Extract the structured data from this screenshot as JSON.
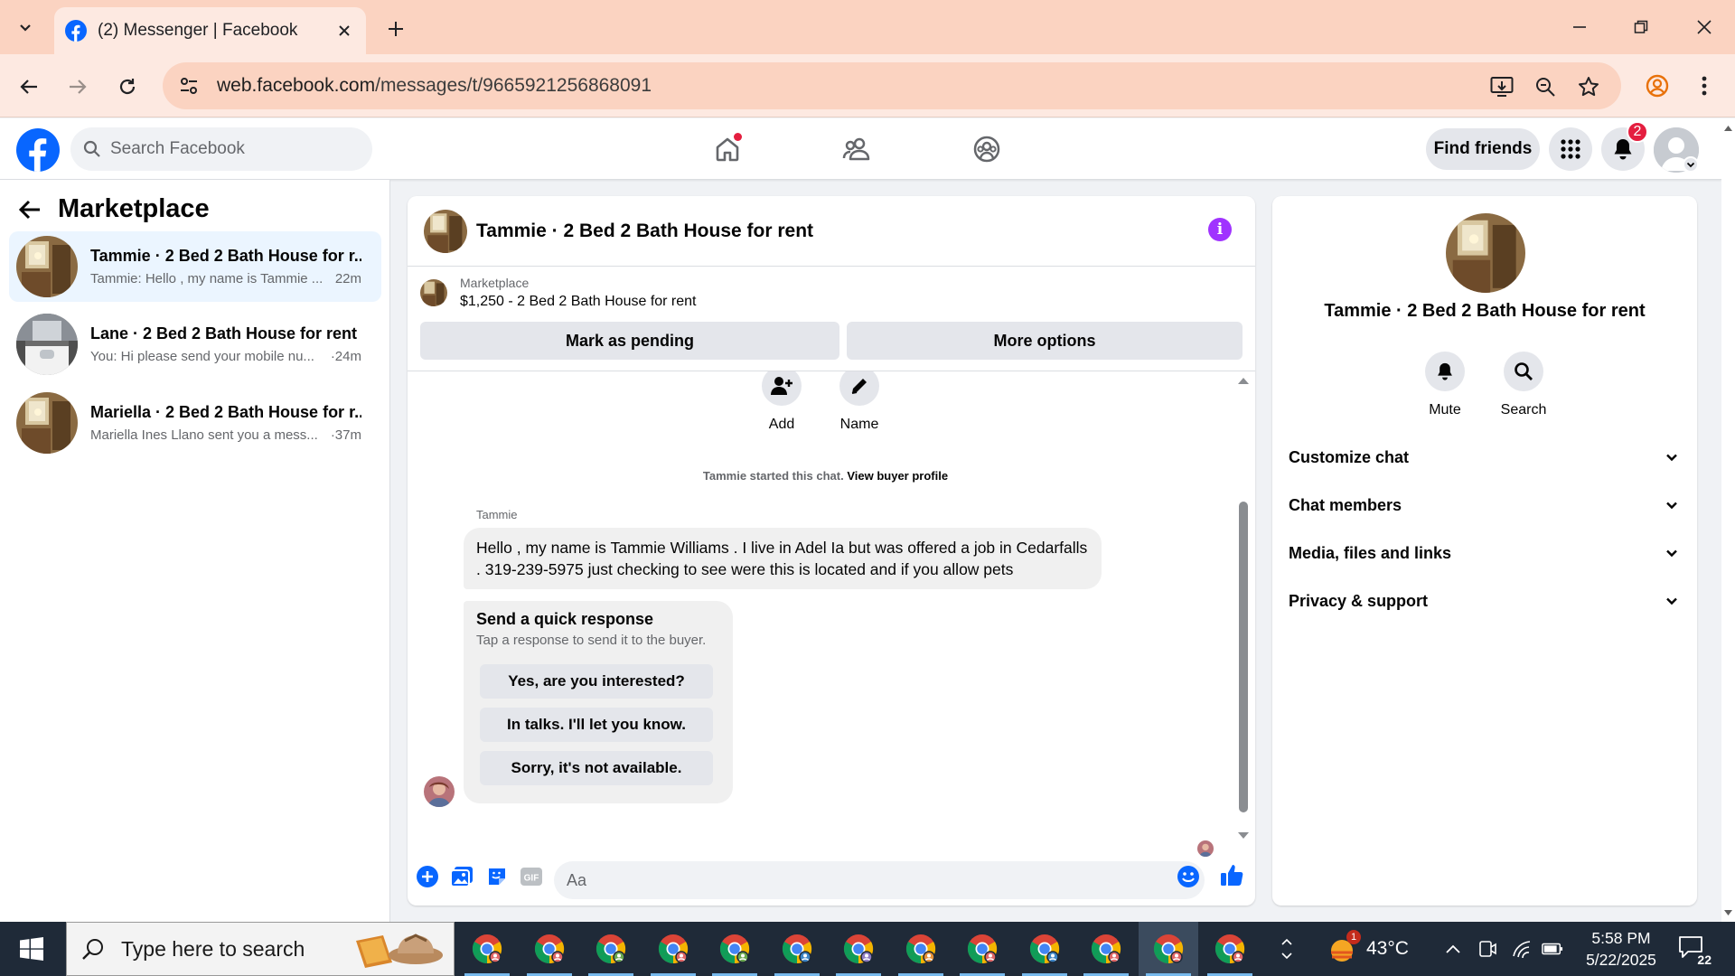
{
  "browser": {
    "tab_title": "(2) Messenger | Facebook",
    "url_host": "web.facebook.com",
    "url_path": "/messages/t/9665921256868091",
    "chrome_color": "#fbd3c1"
  },
  "facebook": {
    "search_placeholder": "Search Facebook",
    "find_friends_label": "Find friends",
    "notification_count": "2",
    "brand_color": "#0866ff"
  },
  "sidebar": {
    "title": "Marketplace",
    "conversations": [
      {
        "name": "Tammie · 2 Bed 2 Bath House for r...",
        "preview": "Tammie: Hello , my name is Tammie ...",
        "time": "22m",
        "active": true
      },
      {
        "name": "Lane · 2 Bed 2 Bath House for rent",
        "preview": "You: Hi please send your mobile nu...",
        "time": "·24m",
        "active": false
      },
      {
        "name": "Mariella · 2 Bed 2 Bath House for r...",
        "preview": "Mariella Ines Llano sent you a mess...",
        "time": "·37m",
        "active": false
      }
    ]
  },
  "chat": {
    "title": "Tammie · 2 Bed 2 Bath House for rent",
    "listing_source": "Marketplace",
    "listing_title": "$1,250 - 2 Bed 2 Bath House for rent",
    "mark_pending_label": "Mark as pending",
    "more_options_label": "More options",
    "add_label": "Add",
    "name_label": "Name",
    "started_text": "Tammie started this chat. ",
    "view_profile_label": "View buyer profile",
    "sender_name": "Tammie",
    "message": "Hello , my name is Tammie Williams . I live in Adel Ia but was offered a job in Cedarfalls . 319-239-5975 just checking to see were this is located and if you allow pets",
    "quick_title": "Send a quick response",
    "quick_subtitle": "Tap a response to send it to the buyer.",
    "quick_replies": [
      "Yes, are you interested?",
      "In talks. I'll let you know.",
      "Sorry, it's not available."
    ],
    "composer_placeholder": "Aa",
    "accent_color": "#0866ff"
  },
  "info_panel": {
    "name": "Tammie · 2 Bed 2 Bath House for rent",
    "mute_label": "Mute",
    "search_label": "Search",
    "sections": [
      "Customize chat",
      "Chat members",
      "Media, files and links",
      "Privacy & support"
    ]
  },
  "taskbar": {
    "search_placeholder": "Type here to search",
    "temperature": "43°C",
    "weather_badge": "1",
    "time": "5:58 PM",
    "date": "5/22/2025",
    "notification_count": "22"
  }
}
